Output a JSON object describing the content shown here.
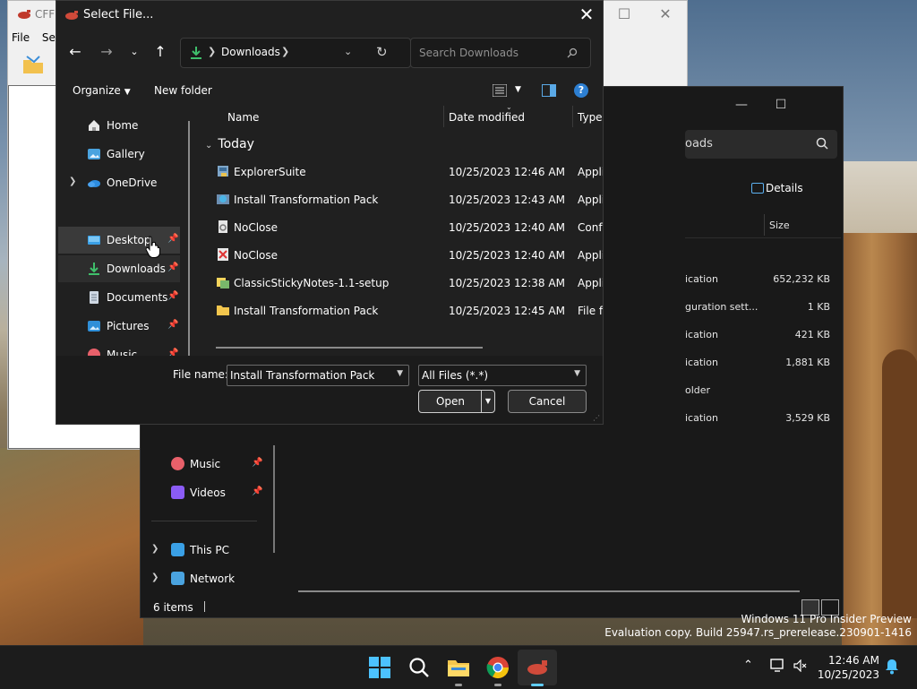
{
  "cff_window": {
    "title": "CFF E",
    "menu": [
      "File",
      "Sett"
    ]
  },
  "explorer_window": {
    "search_text": "oads",
    "details_label": "Details",
    "size_header": "Size",
    "rows": [
      {
        "kind": "ication",
        "size": "652,232 KB"
      },
      {
        "kind": "guration sett...",
        "size": "1 KB"
      },
      {
        "kind": "ication",
        "size": "421 KB"
      },
      {
        "kind": "ication",
        "size": "1,881 KB"
      },
      {
        "kind": "older",
        "size": ""
      },
      {
        "kind": "ication",
        "size": "3,529 KB"
      }
    ],
    "nav_items": [
      {
        "label": "Music",
        "pinned": true
      },
      {
        "label": "Videos",
        "pinned": true
      },
      {
        "label": "This PC",
        "pinned": false
      },
      {
        "label": "Network",
        "pinned": false
      }
    ],
    "status": "6 items"
  },
  "dialog": {
    "title": "Select File...",
    "address": "Downloads",
    "search_placeholder": "Search Downloads",
    "commands": {
      "organize": "Organize",
      "new_folder": "New folder"
    },
    "nav_items": [
      {
        "label": "Home",
        "icon": "home-icon"
      },
      {
        "label": "Gallery",
        "icon": "gallery-icon"
      },
      {
        "label": "OneDrive",
        "icon": "onedrive-icon"
      },
      {
        "label": "Desktop",
        "icon": "desktop-icon"
      },
      {
        "label": "Downloads",
        "icon": "downloads-icon"
      },
      {
        "label": "Documents",
        "icon": "documents-icon"
      },
      {
        "label": "Pictures",
        "icon": "pictures-icon"
      },
      {
        "label": "Music",
        "icon": "music-icon"
      }
    ],
    "columns": {
      "name": "Name",
      "date": "Date modified",
      "type": "Type"
    },
    "group": "Today",
    "files": [
      {
        "name": "ExplorerSuite",
        "date": "10/25/2023 12:46 AM",
        "type": "Appli",
        "icon": "installer-icon"
      },
      {
        "name": "Install Transformation Pack",
        "date": "10/25/2023 12:43 AM",
        "type": "Appli",
        "icon": "installer-icon"
      },
      {
        "name": "NoClose",
        "date": "10/25/2023 12:40 AM",
        "type": "Conf",
        "icon": "config-file-icon"
      },
      {
        "name": "NoClose",
        "date": "10/25/2023 12:40 AM",
        "type": "Appli",
        "icon": "app-icon"
      },
      {
        "name": "ClassicStickyNotes-1.1-setup",
        "date": "10/25/2023 12:38 AM",
        "type": "Appli",
        "icon": "setup-icon"
      },
      {
        "name": "Install Transformation Pack",
        "date": "10/25/2023 12:45 AM",
        "type": "File fo",
        "icon": "folder-icon"
      }
    ],
    "file_name_label": "File name:",
    "file_name_value": "Install Transformation Pack",
    "file_type": "All Files (*.*)",
    "open_label": "Open",
    "cancel_label": "Cancel"
  },
  "watermark": {
    "line1": "Windows 11 Pro Insider Preview",
    "line2": "Evaluation copy. Build 25947.rs_prerelease.230901-1416"
  },
  "taskbar": {
    "apps": [
      "start-icon",
      "search-icon",
      "file-explorer-icon",
      "chrome-icon",
      "cff-explorer-icon"
    ],
    "time": "12:46 AM",
    "date": "10/25/2023"
  },
  "colors": {
    "dialog_bg": "#202020",
    "accent": "#60cdff",
    "selected_nav": "#3a3a3a"
  }
}
